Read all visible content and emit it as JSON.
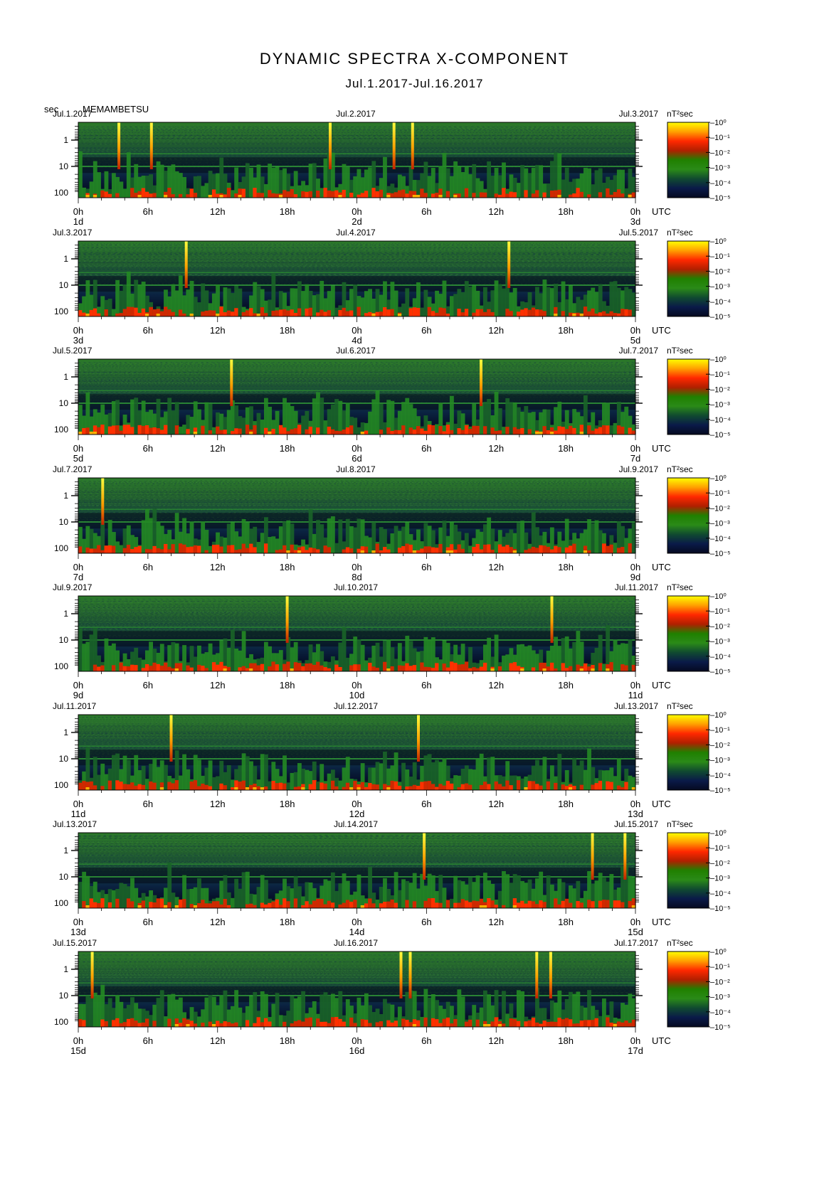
{
  "page": {
    "title": "DYNAMIC SPECTRA X-COMPONENT",
    "subtitle": "Jul.1.2017-Jul.16.2017",
    "y_unit": "sec",
    "station": "MEMAMBETSU"
  },
  "chart_data": {
    "type": "heatmap",
    "title": "DYNAMIC SPECTRA X-COMPONENT",
    "subtitle": "Jul.1.2017-Jul.16.2017",
    "ylabel": "sec",
    "yscale": "log",
    "y_ticks": [
      "1",
      "10",
      "100"
    ],
    "x_ticks": [
      "0h",
      "6h",
      "12h",
      "18h",
      "0h",
      "6h",
      "12h",
      "18h",
      "0h"
    ],
    "x_unit": "UTC",
    "colorbar": {
      "unit": "nT²sec",
      "ticks": [
        "10⁰",
        "10⁻¹",
        "10⁻²",
        "10⁻³",
        "10⁻⁴",
        "10⁻⁵"
      ],
      "colors": [
        "#ffff00",
        "#ffa000",
        "#ff2800",
        "#b02000",
        "#208000",
        "#2a8a18",
        "#104a30",
        "#0a1a48",
        "#050a20"
      ]
    },
    "panels": [
      {
        "date_left": "Jul.1.2017",
        "date_mid": "Jul.2.2017",
        "date_right": "Jul.3.2017",
        "day_left": "1d",
        "day_mid": "2d",
        "day_right": "3d",
        "spikes_h": [
          3.5,
          6.3,
          21.7,
          27.2,
          28.8
        ]
      },
      {
        "date_left": "Jul.3.2017",
        "date_mid": "Jul.4.2017",
        "date_right": "Jul.5.2017",
        "day_left": "3d",
        "day_mid": "4d",
        "day_right": "5d",
        "spikes_h": [
          9.3,
          37.1
        ]
      },
      {
        "date_left": "Jul.5.2017",
        "date_mid": "Jul.6.2017",
        "date_right": "Jul.7.2017",
        "day_left": "5d",
        "day_mid": "6d",
        "day_right": "7d",
        "spikes_h": [
          13.2,
          34.7
        ]
      },
      {
        "date_left": "Jul.7.2017",
        "date_mid": "Jul.8.2017",
        "date_right": "Jul.9.2017",
        "day_left": "7d",
        "day_mid": "8d",
        "day_right": "9d",
        "spikes_h": [
          2.1
        ]
      },
      {
        "date_left": "Jul.9.2017",
        "date_mid": "Jul.10.2017",
        "date_right": "Jul.11.2017",
        "day_left": "9d",
        "day_mid": "10d",
        "day_right": "11d",
        "spikes_h": [
          18.0,
          40.8
        ]
      },
      {
        "date_left": "Jul.11.2017",
        "date_mid": "Jul.12.2017",
        "date_right": "Jul.13.2017",
        "day_left": "11d",
        "day_mid": "12d",
        "day_right": "13d",
        "spikes_h": [
          8.0,
          29.3
        ]
      },
      {
        "date_left": "Jul.13.2017",
        "date_mid": "Jul.14.2017",
        "date_right": "Jul.15.2017",
        "day_left": "13d",
        "day_mid": "14d",
        "day_right": "15d",
        "spikes_h": [
          29.8,
          44.3,
          47.1
        ]
      },
      {
        "date_left": "Jul.15.2017",
        "date_mid": "Jul.16.2017",
        "date_right": "Jul.17.2017",
        "day_left": "15d",
        "day_mid": "16d",
        "day_right": "17d",
        "spikes_h": [
          1.2,
          27.8,
          28.6,
          39.5,
          40.7
        ]
      }
    ]
  }
}
